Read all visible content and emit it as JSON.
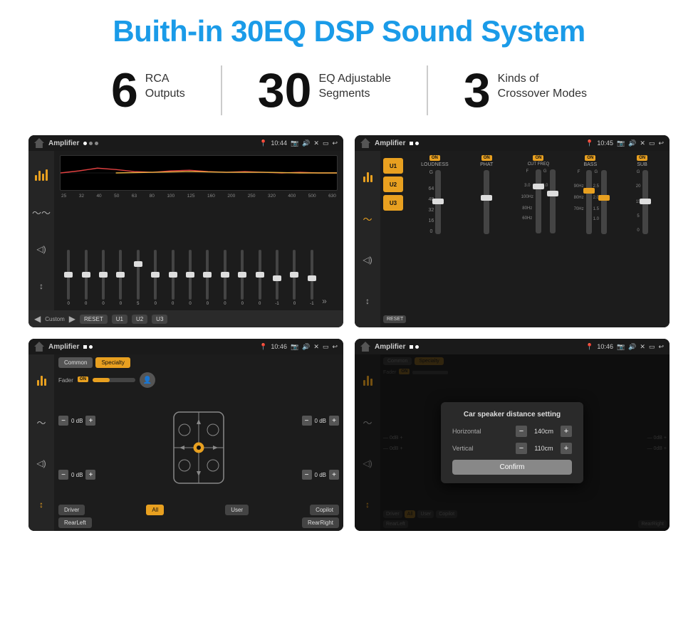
{
  "title": "Buith-in 30EQ DSP Sound System",
  "stats": [
    {
      "number": "6",
      "line1": "RCA",
      "line2": "Outputs"
    },
    {
      "number": "30",
      "line1": "EQ Adjustable",
      "line2": "Segments"
    },
    {
      "number": "3",
      "line1": "Kinds of",
      "line2": "Crossover Modes"
    }
  ],
  "screens": [
    {
      "id": "screen1",
      "status_title": "Amplifier",
      "status_time": "10:44",
      "type": "eq"
    },
    {
      "id": "screen2",
      "status_title": "Amplifier",
      "status_time": "10:45",
      "type": "amp"
    },
    {
      "id": "screen3",
      "status_title": "Amplifier",
      "status_time": "10:46",
      "type": "crossover"
    },
    {
      "id": "screen4",
      "status_title": "Amplifier",
      "status_time": "10:46",
      "type": "dialog"
    }
  ],
  "eq_freqs": [
    "25",
    "32",
    "40",
    "50",
    "63",
    "80",
    "100",
    "125",
    "160",
    "200",
    "250",
    "320",
    "400",
    "500",
    "630"
  ],
  "eq_vals": [
    "0",
    "0",
    "0",
    "0",
    "5",
    "0",
    "0",
    "0",
    "0",
    "0",
    "0",
    "0",
    "-1",
    "0",
    "-1"
  ],
  "eq_presets": [
    "Custom",
    "RESET",
    "U1",
    "U2",
    "U3"
  ],
  "amp_channels": [
    "LOUDNESS",
    "PHAT",
    "CUT FREQ",
    "BASS",
    "SUB"
  ],
  "amp_presets": [
    "U1",
    "U2",
    "U3"
  ],
  "crossover_tabs": [
    "Common",
    "Specialty"
  ],
  "crossover_btns": [
    "Driver",
    "All",
    "User",
    "Copilot",
    "RearLeft",
    "RearRight"
  ],
  "dialog": {
    "title": "Car speaker distance setting",
    "horizontal_label": "Horizontal",
    "horizontal_val": "140cm",
    "vertical_label": "Vertical",
    "vertical_val": "110cm",
    "confirm_label": "Confirm"
  },
  "on_label": "ON",
  "fader_label": "Fader",
  "reset_label": "RESET"
}
